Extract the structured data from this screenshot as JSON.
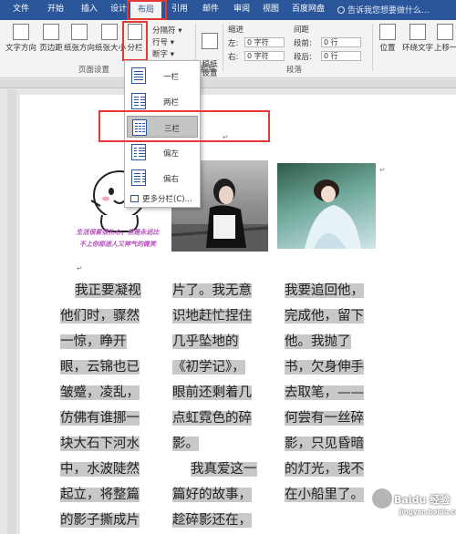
{
  "tabs": [
    {
      "label": "文件"
    },
    {
      "label": "开始"
    },
    {
      "label": "插入"
    },
    {
      "label": "设计"
    },
    {
      "label": "布局"
    },
    {
      "label": "引用"
    },
    {
      "label": "邮件"
    },
    {
      "label": "审阅"
    },
    {
      "label": "视图"
    },
    {
      "label": "百度网盘"
    }
  ],
  "tell_me": "告诉我您想要做什么...",
  "ribbon": {
    "text_direction": "文字方向",
    "margins": "页边距",
    "orientation": "纸张方向",
    "size": "纸张大小",
    "columns": "分栏",
    "breaks": "分隔符 ▾",
    "line_numbers": "行号 ▾",
    "hyphenation": "断字 ▾",
    "draft_settings": "稿纸\n设置",
    "indent_title": "缩进",
    "spacing_title": "间距",
    "indent_left_label": "左:",
    "indent_left_value": "0 字符",
    "indent_right_label": "右:",
    "indent_right_value": "0 字符",
    "spacing_before_label": "段前:",
    "spacing_before_value": "0 行",
    "spacing_after_label": "段后:",
    "spacing_after_value": "0 行",
    "position": "位置",
    "wrap_text": "环绕文字",
    "bring_forward": "上移一层",
    "group_page_setup": "页面设置",
    "group_draft": "稿纸",
    "group_paragraph": "段落"
  },
  "columns_menu": {
    "items": [
      {
        "label": "一栏"
      },
      {
        "label": "两栏"
      },
      {
        "label": "三栏"
      },
      {
        "label": "偏左"
      },
      {
        "label": "偏右"
      }
    ],
    "selected": "三栏",
    "more": "更多分栏(C)..."
  },
  "document": {
    "caption_line1": "生活很累很扎心，但是永远比",
    "caption_line2": "不上你那迷人又神气的微笑",
    "column1": [
      "我正要凝视",
      "他们时，骤然",
      "一惊，睁开",
      "眼，云锦也已",
      "皱蹙，凌乱，",
      "仿佛有谁挪一",
      "块大石下河水",
      "中，水波陡然",
      "起立，将整篇",
      "的影子撕成片"
    ],
    "column2": [
      "片了。我无意",
      "识地赶忙捏住",
      "几乎坠地的",
      "《初学记》，",
      "眼前还剩着几",
      "点虹霓色的碎",
      "影。",
      "我真爱这一",
      "篇好的故事，",
      "趁碎影还在，"
    ],
    "column3": [
      "我要追回他，",
      "完成他，留下",
      "他。我抛了",
      "书，欠身伸手",
      "去取笔，——",
      "何尝有一丝碎",
      "影，只见昏暗",
      "的灯光，我不",
      "在小船里了。"
    ]
  },
  "watermark": {
    "line1": "Baidu 经验",
    "line2": "jingyan.baidu.com"
  }
}
